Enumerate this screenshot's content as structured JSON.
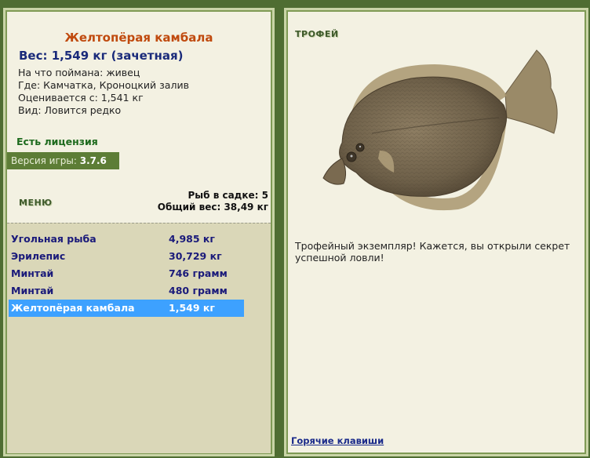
{
  "fish": {
    "title": "Желтопёрая камбала",
    "weight": "Вес: 1,549 кг (зачетная)",
    "bait": "На что поймана: живец",
    "place": "Где: Камчатка, Кроноцкий залив",
    "value": "Оценивается с: 1,541 кг",
    "kind": "Вид: Ловится редко"
  },
  "license": "Есть лицензия",
  "version": {
    "label": "Версия игры:",
    "number": "3.7.6"
  },
  "menu_label": "МЕНЮ",
  "keepnet": {
    "count": "Рыб в садке: 5",
    "total": "Общий вес: 38,49 кг"
  },
  "catch": [
    {
      "name": "Угольная рыба",
      "weight": "4,985 кг"
    },
    {
      "name": "Эрилепис",
      "weight": "30,729 кг"
    },
    {
      "name": "Минтай",
      "weight": "746 грамм"
    },
    {
      "name": "Минтай",
      "weight": "480 грамм"
    },
    {
      "name": "Желтопёрая камбала",
      "weight": "1,549 кг"
    }
  ],
  "selected_index": 4,
  "trophy": {
    "label": "ТРОФЕЙ",
    "text": "Трофейный экземпляр! Кажется, вы открыли секрет успешной ловли!"
  },
  "hotkeys": "Горячие клавиши",
  "colors": {
    "frame": "#4f6d32",
    "panel": "#f3f1e2",
    "selected": "#3da1ff",
    "title": "#c04a0e"
  }
}
